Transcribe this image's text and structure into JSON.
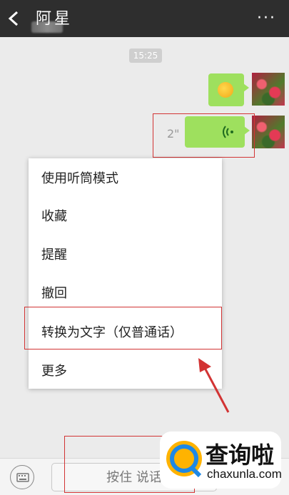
{
  "header": {
    "title": "阿星",
    "more_label": "···"
  },
  "chat": {
    "timestamp": "15:25",
    "voice_duration": "2\""
  },
  "context_menu": {
    "items": [
      {
        "label": "使用听筒模式"
      },
      {
        "label": "收藏"
      },
      {
        "label": "提醒"
      },
      {
        "label": "撤回"
      },
      {
        "label": "转换为文字（仅普通话）"
      },
      {
        "label": "更多"
      }
    ]
  },
  "input_bar": {
    "hold_to_talk": "按住 说话"
  },
  "watermark": {
    "brand": "查询啦",
    "domain": "chaxunla.com"
  },
  "colors": {
    "bubble": "#9ee05e",
    "topbar": "#2e2e2e",
    "annotation": "#d23434",
    "brand": "#1e88e5"
  }
}
